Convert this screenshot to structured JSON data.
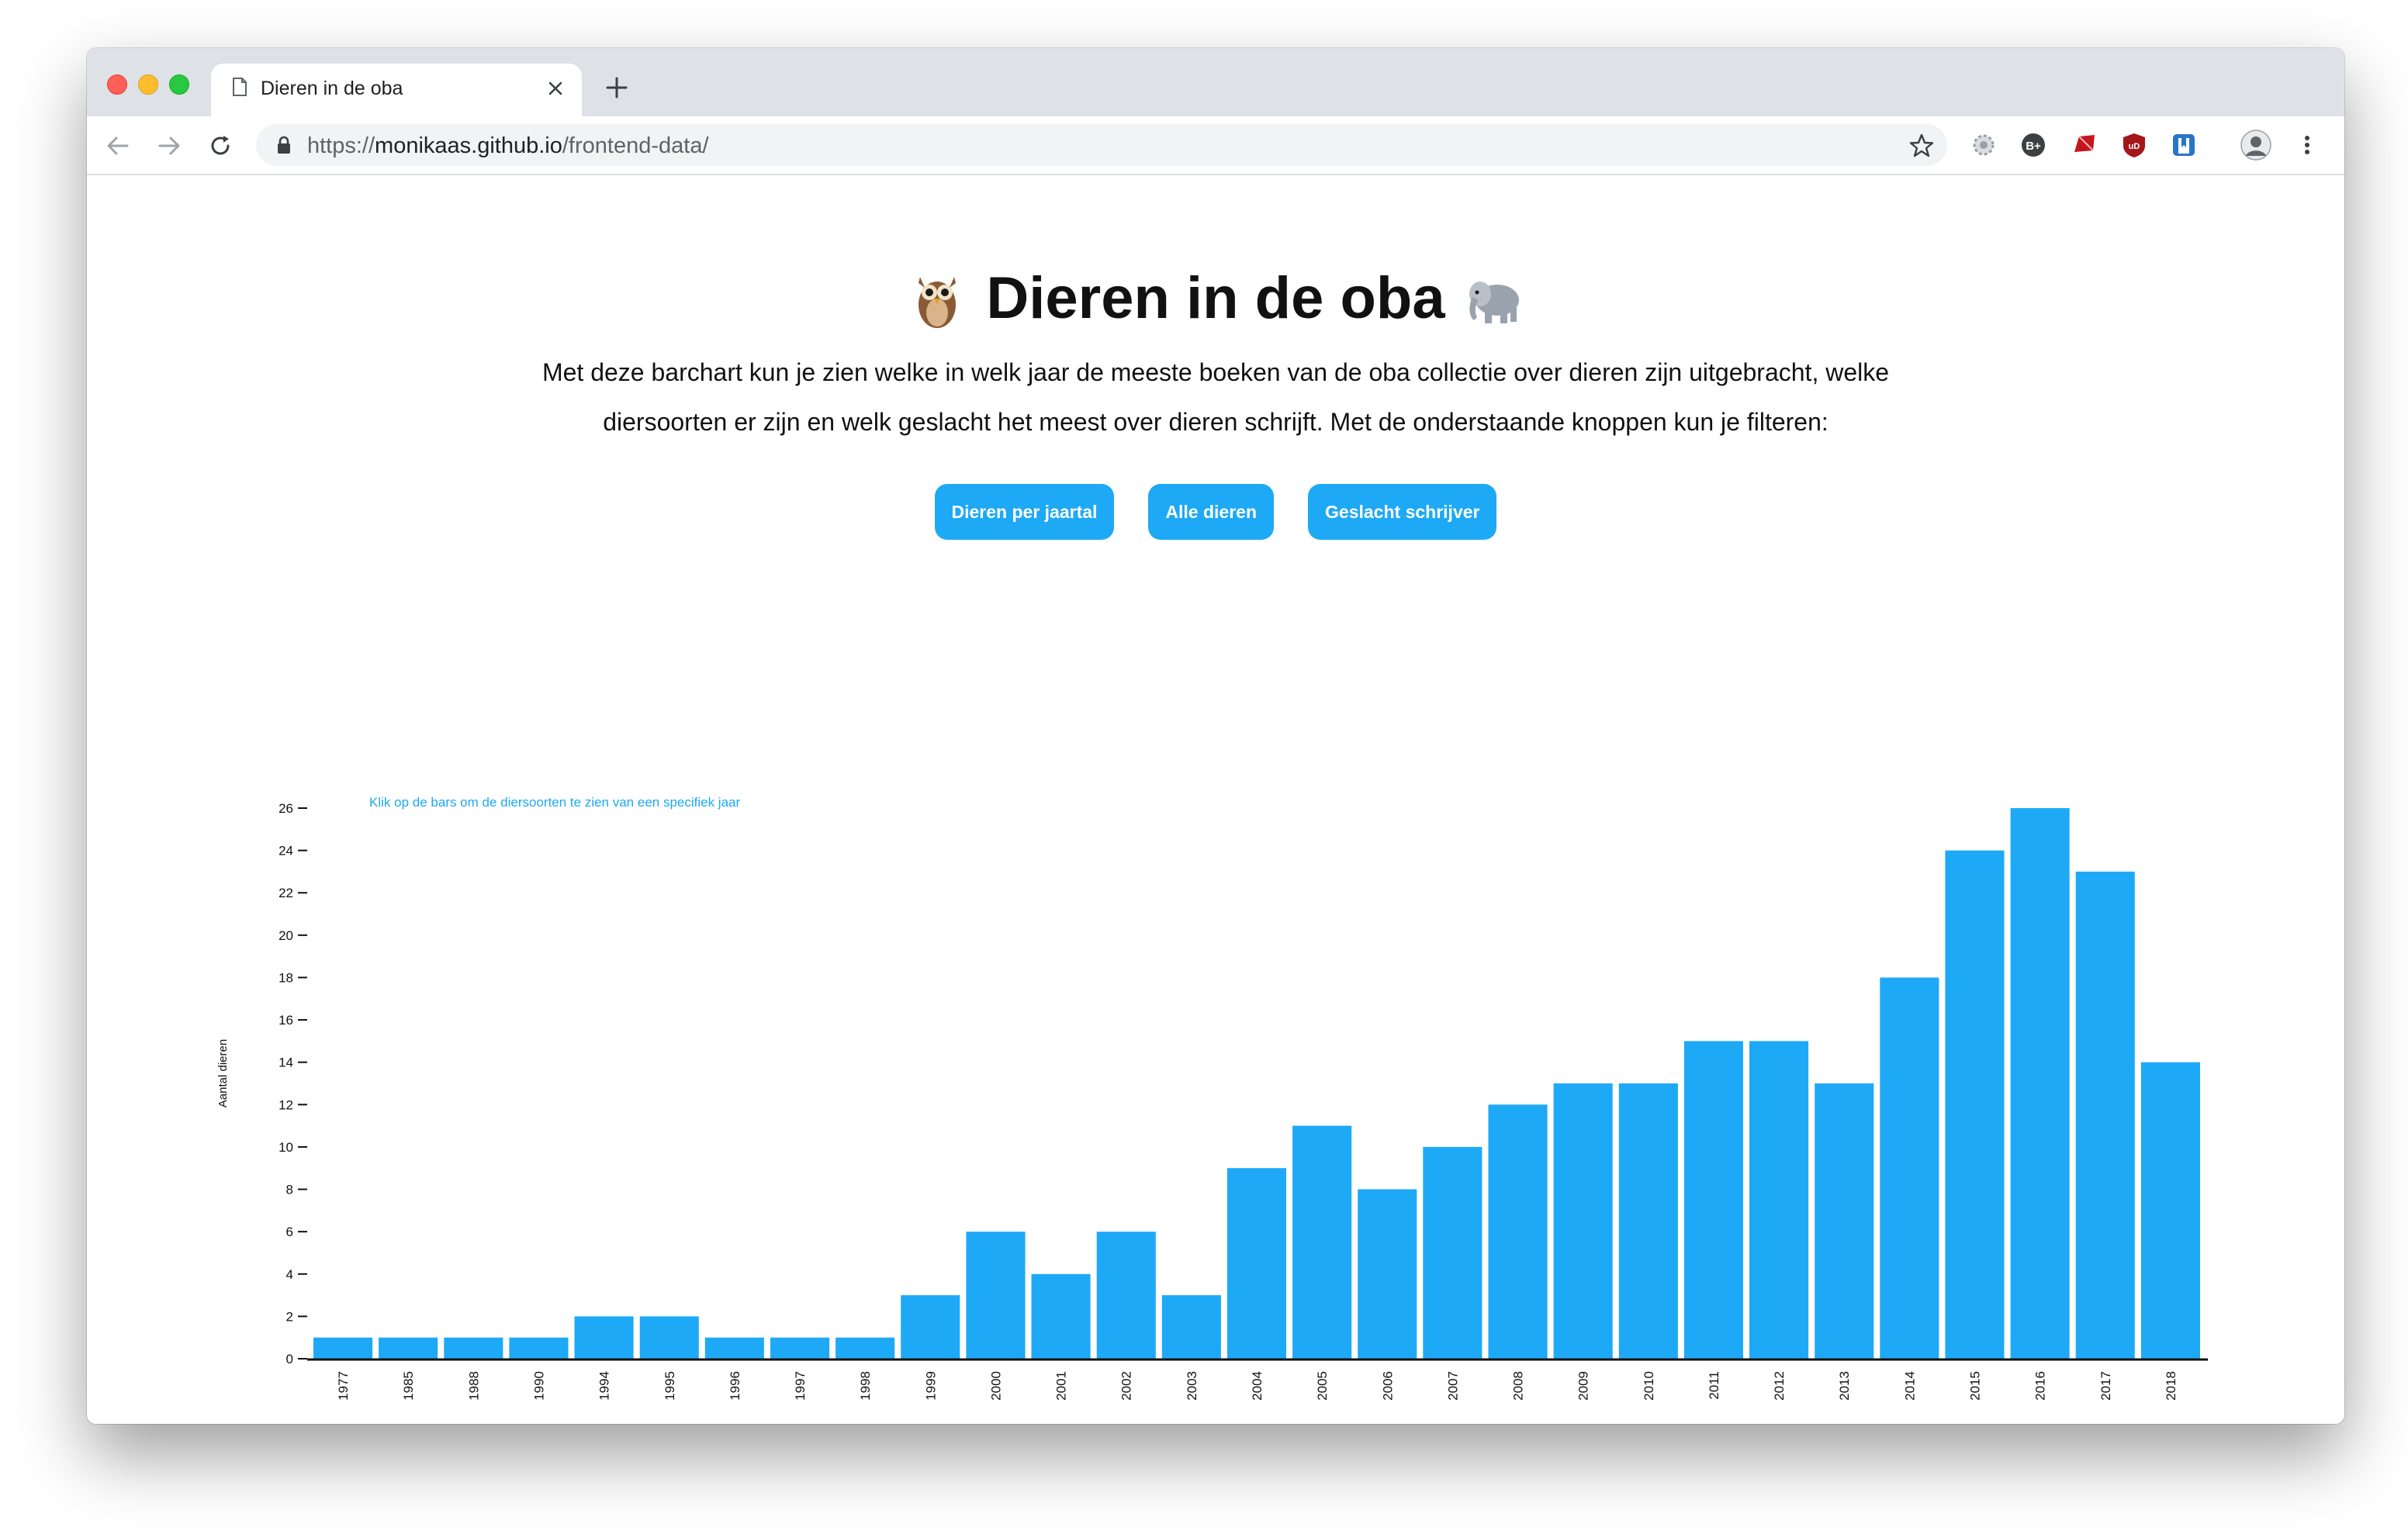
{
  "browser": {
    "tab_title": "Dieren in de oba",
    "url_scheme": "https://",
    "url_host": "monikaas.github.io",
    "url_path": "/frontend-data/",
    "extensions": [
      {
        "name": "settings-gear",
        "label": "",
        "color": "#9aa0a6"
      },
      {
        "name": "b-plus",
        "label": "B+",
        "color": "#3c4043"
      },
      {
        "name": "ruby",
        "label": "",
        "color": "#c5161d"
      },
      {
        "name": "ublock",
        "label": "uD",
        "color": "#a4161a"
      },
      {
        "name": "bookmark-square",
        "label": "",
        "color": "#2a75c8"
      },
      {
        "name": "profile",
        "label": "",
        "color": "#5f6368"
      }
    ]
  },
  "page": {
    "title": "Dieren in de oba",
    "intro": "Met deze barchart kun je zien welke in welk jaar de meeste boeken van de oba collectie over dieren zijn uitgebracht, welke diersoorten er zijn en welk geslacht het meest over dieren schrijft. Met de onderstaande knoppen kun je filteren:",
    "buttons": [
      {
        "label": "Dieren per jaartal"
      },
      {
        "label": "Alle dieren"
      },
      {
        "label": "Geslacht schrijver"
      }
    ]
  },
  "colors": {
    "accent": "#1da9f5",
    "bar": "#1ea9f7",
    "text": "#111111"
  },
  "chart_data": {
    "type": "bar",
    "title": "",
    "annotation": "Klik op de bars om de diersoorten te zien van een specifiek jaar",
    "xlabel": "",
    "ylabel": "Aantal dieren",
    "ylim": [
      0,
      26
    ],
    "yticks": [
      0,
      2,
      4,
      6,
      8,
      10,
      12,
      14,
      16,
      18,
      20,
      22,
      24,
      26
    ],
    "grid": false,
    "categories": [
      "1977",
      "1985",
      "1988",
      "1990",
      "1994",
      "1995",
      "1996",
      "1997",
      "1998",
      "1999",
      "2000",
      "2001",
      "2002",
      "2003",
      "2004",
      "2005",
      "2006",
      "2007",
      "2008",
      "2009",
      "2010",
      "2011",
      "2012",
      "2013",
      "2014",
      "2015",
      "2016",
      "2017",
      "2018"
    ],
    "values": [
      1,
      1,
      1,
      1,
      2,
      2,
      1,
      1,
      1,
      3,
      6,
      4,
      6,
      3,
      9,
      11,
      8,
      10,
      12,
      13,
      13,
      15,
      15,
      13,
      18,
      24,
      26,
      23,
      14
    ]
  }
}
